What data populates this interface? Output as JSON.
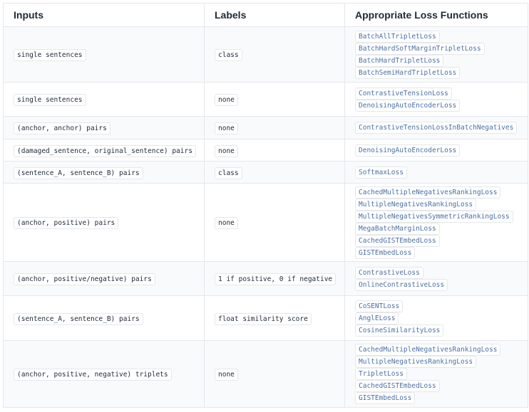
{
  "header": {
    "inputs": "Inputs",
    "labels": "Labels",
    "losses": "Appropriate Loss Functions"
  },
  "rows": [
    {
      "inputs": "single sentences",
      "labels": "class",
      "losses": [
        "BatchAllTripletLoss",
        "BatchHardSoftMarginTripletLoss",
        "BatchHardTripletLoss",
        "BatchSemiHardTripletLoss"
      ]
    },
    {
      "inputs": "single sentences",
      "labels": "none",
      "losses": [
        "ContrastiveTensionLoss",
        "DenoisingAutoEncoderLoss"
      ]
    },
    {
      "inputs": "(anchor, anchor) pairs",
      "labels": "none",
      "losses": [
        "ContrastiveTensionLossInBatchNegatives"
      ]
    },
    {
      "inputs": "(damaged_sentence, original_sentence) pairs",
      "labels": "none",
      "losses": [
        "DenoisingAutoEncoderLoss"
      ]
    },
    {
      "inputs": "(sentence_A, sentence_B) pairs",
      "labels": "class",
      "losses": [
        "SoftmaxLoss"
      ]
    },
    {
      "inputs": "(anchor, positive) pairs",
      "labels": "none",
      "losses": [
        "CachedMultipleNegativesRankingLoss",
        "MultipleNegativesRankingLoss",
        "MultipleNegativesSymmetricRankingLoss",
        "MegaBatchMarginLoss",
        "CachedGISTEmbedLoss",
        "GISTEmbedLoss"
      ]
    },
    {
      "inputs": "(anchor, positive/negative) pairs",
      "labels": "1 if positive, 0 if negative",
      "losses": [
        "ContrastiveLoss",
        "OnlineContrastiveLoss"
      ]
    },
    {
      "inputs": "(sentence_A, sentence_B) pairs",
      "labels": "float similarity score",
      "losses": [
        "CoSENTLoss",
        "AnglELoss",
        "CosineSimilarityLoss"
      ]
    },
    {
      "inputs": "(anchor, positive, negative) triplets",
      "labels": "none",
      "losses": [
        "CachedMultipleNegativesRankingLoss",
        "MultipleNegativesRankingLoss",
        "TripletLoss",
        "CachedGISTEmbedLoss",
        "GISTEmbedLoss"
      ]
    }
  ]
}
